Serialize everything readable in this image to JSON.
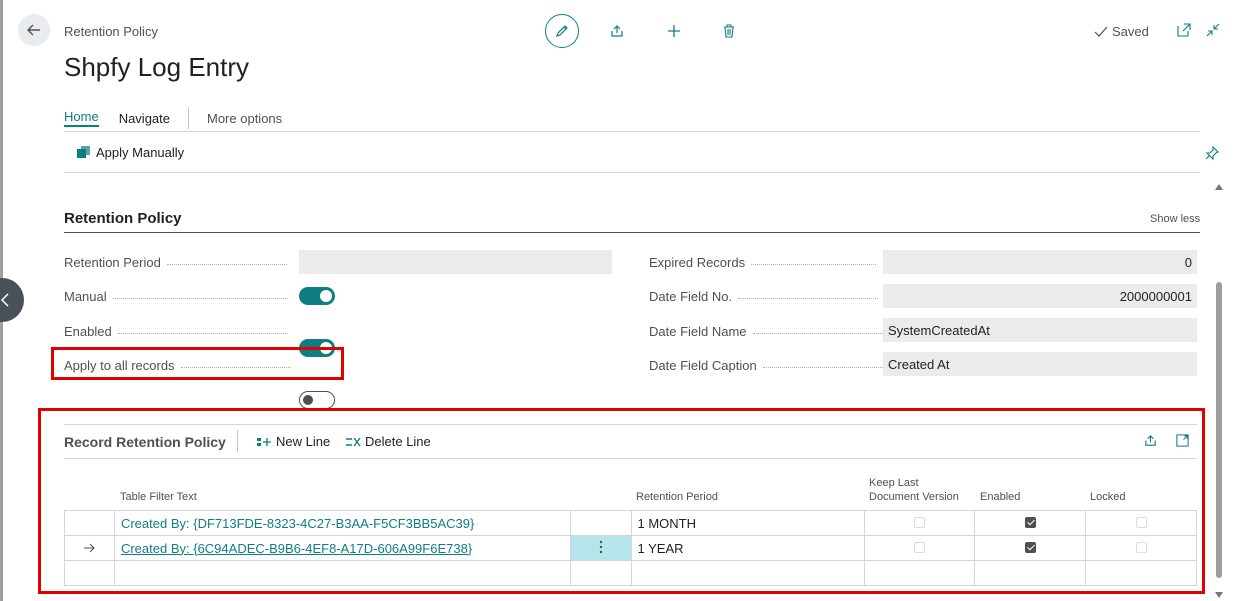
{
  "header": {
    "breadcrumb": "Retention Policy",
    "title": "Shpfy Log Entry",
    "saved_label": "Saved"
  },
  "tabs": [
    {
      "label": "Home",
      "active": true
    },
    {
      "label": "Navigate",
      "active": false
    },
    {
      "label": "More options",
      "active": false
    }
  ],
  "actions": {
    "apply_manually": "Apply Manually"
  },
  "section": {
    "title": "Retention Policy",
    "toggle_label": "Show less"
  },
  "fields_left": {
    "retention_period": {
      "label": "Retention Period",
      "value": ""
    },
    "manual": {
      "label": "Manual",
      "value": true
    },
    "enabled": {
      "label": "Enabled",
      "value": true
    },
    "apply_all": {
      "label": "Apply to all records",
      "value": false
    }
  },
  "fields_right": {
    "expired_records": {
      "label": "Expired Records",
      "value": "0"
    },
    "date_field_no": {
      "label": "Date Field No.",
      "value": "2000000001"
    },
    "date_field_name": {
      "label": "Date Field Name",
      "value": "SystemCreatedAt"
    },
    "date_field_caption": {
      "label": "Date Field Caption",
      "value": "Created At"
    }
  },
  "subpage": {
    "title": "Record Retention Policy",
    "new_line": "New Line",
    "delete_line": "Delete Line",
    "columns": {
      "filter": "Table Filter Text",
      "period": "Retention Period",
      "keep_last_1": "Keep Last",
      "keep_last_2": "Document Version",
      "enabled": "Enabled",
      "locked": "Locked"
    },
    "rows": [
      {
        "filter": "Created By: {DF713FDE-8323-4C27-B3AA-F5CF3BB5AC39}",
        "period": "1 MONTH",
        "keep_last": false,
        "enabled": true,
        "locked": false
      },
      {
        "filter": "Created By: {6C94ADEC-B9B6-4EF8-A17D-606A99F6E738}",
        "period": "1 YEAR",
        "keep_last": false,
        "enabled": true,
        "locked": false
      }
    ]
  },
  "colors": {
    "accent": "#0f7d84",
    "highlight_box": "#e30000",
    "selected_cell": "#b3e5ea"
  }
}
